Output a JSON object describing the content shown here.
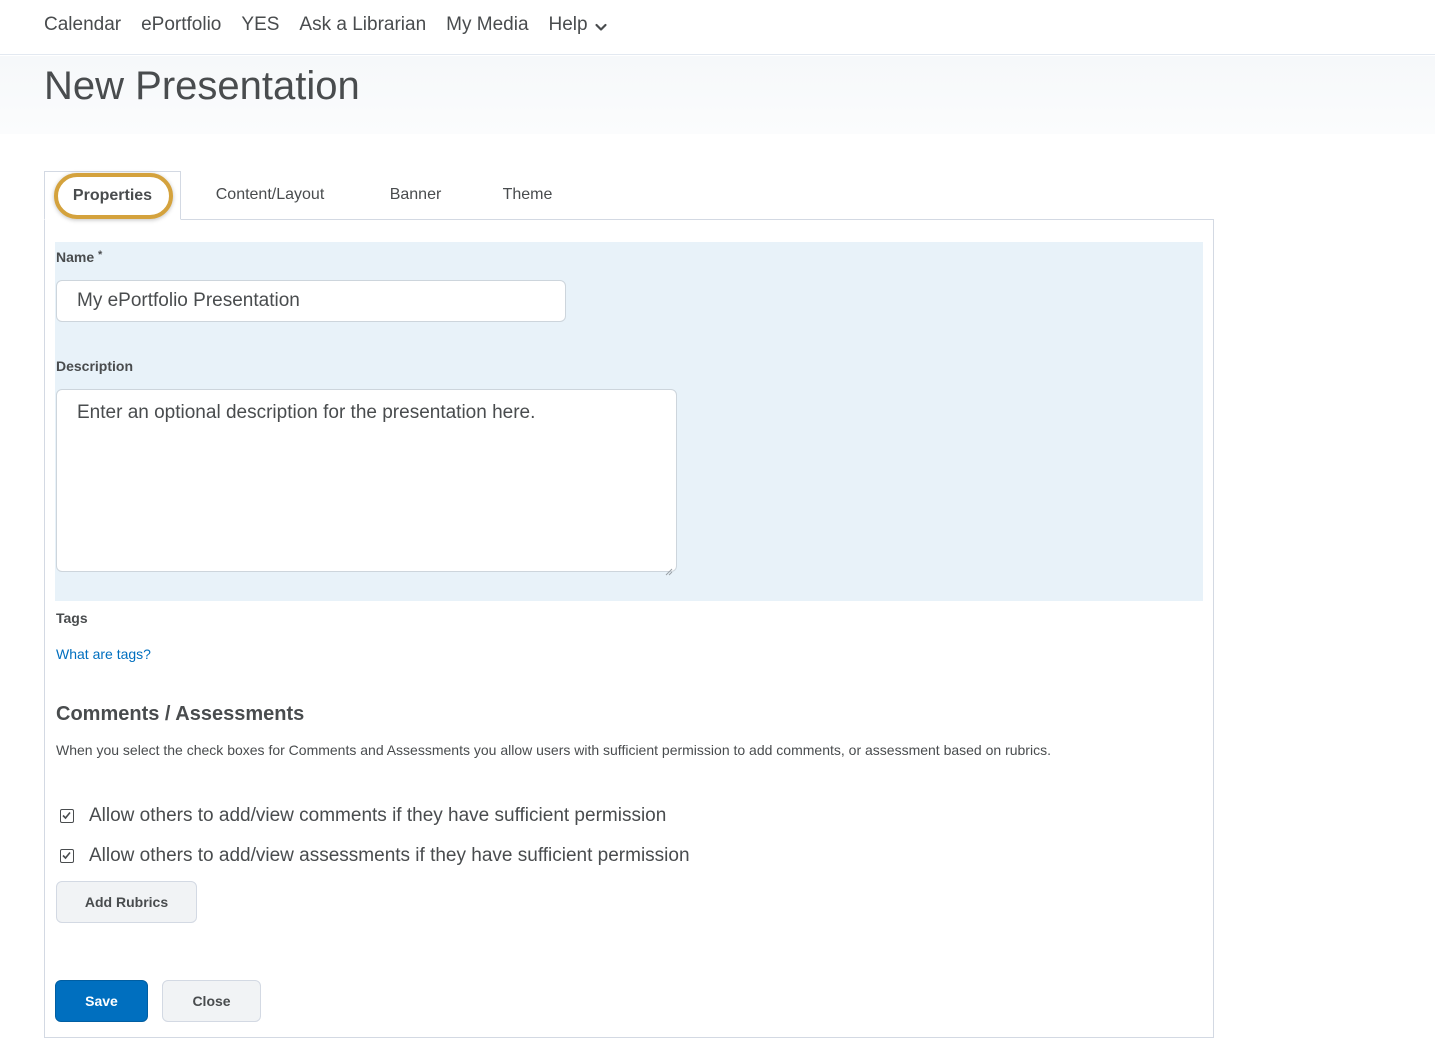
{
  "nav": {
    "items": [
      {
        "label": "Calendar"
      },
      {
        "label": "ePortfolio"
      },
      {
        "label": "YES"
      },
      {
        "label": "Ask a Librarian"
      },
      {
        "label": "My Media"
      },
      {
        "label": "Help"
      }
    ],
    "help_icon": "chevron-down-icon"
  },
  "page": {
    "title": "New Presentation"
  },
  "tabs": [
    {
      "label": "Properties",
      "active": true
    },
    {
      "label": "Content/Layout"
    },
    {
      "label": "Banner"
    },
    {
      "label": "Theme"
    }
  ],
  "form": {
    "name_label": "Name",
    "required_mark": "*",
    "name_value": "My ePortfolio Presentation",
    "description_label": "Description",
    "description_placeholder": "Enter an optional description for the presentation here.",
    "tags_label": "Tags",
    "tags_help_link": "What are tags?"
  },
  "comments": {
    "heading": "Comments / Assessments",
    "help_text": "When you select the check boxes for Comments and Assessments you allow users with sufficient permission to add comments, or assessment based on rubrics.",
    "options": [
      {
        "label": "Allow others to add/view comments if they have sufficient permission",
        "checked": true
      },
      {
        "label": "Allow others to add/view assessments if they have sufficient permission",
        "checked": true
      }
    ],
    "add_rubrics_label": "Add Rubrics"
  },
  "actions": {
    "save_label": "Save",
    "close_label": "Close"
  },
  "colors": {
    "primary": "#006fbf",
    "highlight_ring": "#d4a23d",
    "form_background": "#e8f2f9"
  }
}
